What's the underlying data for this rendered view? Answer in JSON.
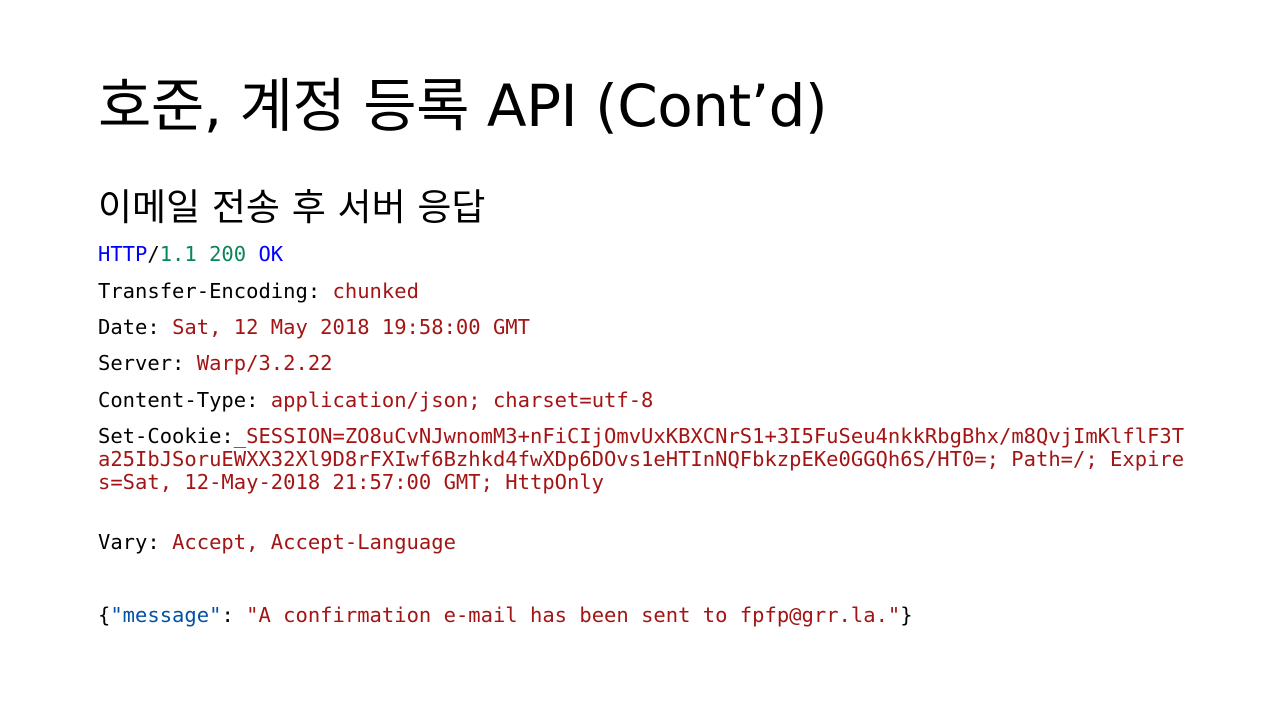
{
  "slide": {
    "title": "호준, 계정 등록 API (Cont’d)",
    "subtitle": "이메일 전송 후 서버 응답"
  },
  "status_line": {
    "protocol": "HTTP",
    "slash": "/",
    "version": "1.1 200",
    "sep": " ",
    "reason": "OK"
  },
  "headers": [
    {
      "name": "Transfer-Encoding:",
      "value": "chunked"
    },
    {
      "name": "Date:",
      "value": "Sat, 12 May 2018 19:58:00 GMT"
    },
    {
      "name": "Server:",
      "value": "Warp/3.2.22"
    },
    {
      "name": "Content-Type:",
      "value": "application/json; charset=utf-8"
    },
    {
      "name": "Set-Cookie:",
      "value": "_SESSION=ZO8uCvNJwnomM3+nFiCIjOmvUxKBXCNrS1+3I5FuSeu4nkkRbgBhx/m8QvjImKlflF3Ta25IbJSoruEWXX32Xl9D8rFXIwf6Bzhkd4fwXDp6DOvs1eHTInNQFbkzpEKe0GGQh6S/HT0=; Path=/; Expires=Sat, 12-May-2018 21:57:00 GMT; HttpOnly"
    },
    {
      "name": "Vary:",
      "value": "Accept, Accept-Language"
    }
  ],
  "body_json": {
    "open_brace": "{",
    "key": "\"message\"",
    "colon": ": ",
    "value": "\"A confirmation e-mail has been sent to fpfp@grr.la.\"",
    "close_brace": "}"
  }
}
